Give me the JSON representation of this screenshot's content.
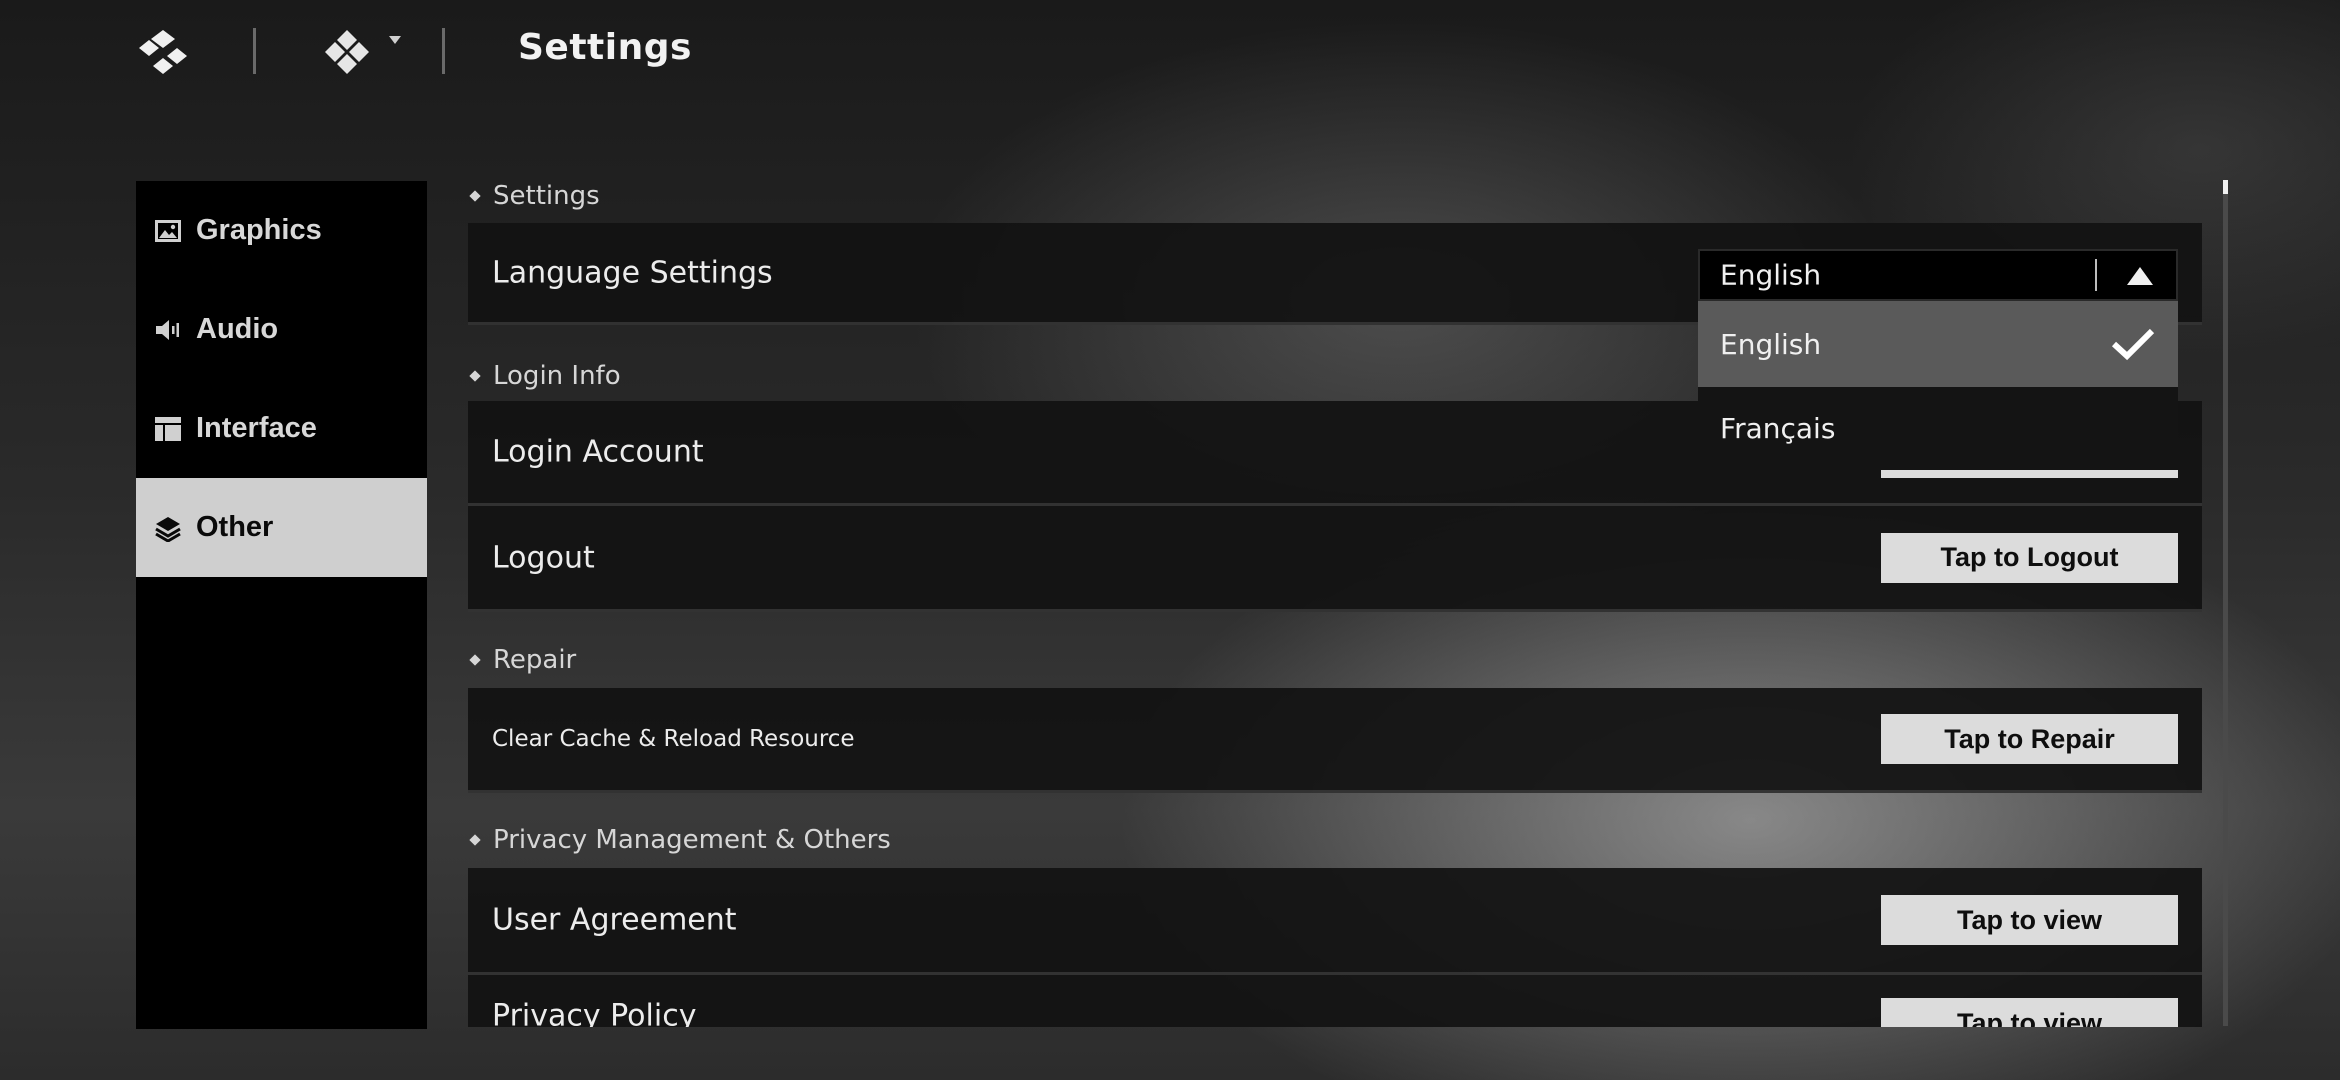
{
  "header": {
    "title": "Settings",
    "logo_icon": "diamond-logo-icon",
    "switch_icon": "four-diamond-icon",
    "switch_caret_icon": "caret-down-icon"
  },
  "sidebar": {
    "items": [
      {
        "label": "Graphics",
        "icon": "image-icon",
        "active": false
      },
      {
        "label": "Audio",
        "icon": "speaker-icon",
        "active": false
      },
      {
        "label": "Interface",
        "icon": "layout-icon",
        "active": false
      },
      {
        "label": "Other",
        "icon": "layers-icon",
        "active": true
      }
    ]
  },
  "sections": {
    "settings": {
      "heading": "Settings",
      "language": {
        "label": "Language Settings"
      }
    },
    "login_info": {
      "heading": "Login Info",
      "login_account": {
        "label": "Login Account"
      },
      "logout": {
        "label": "Logout",
        "button": "Tap to Logout"
      }
    },
    "repair": {
      "heading": "Repair",
      "clear_cache": {
        "label": "Clear Cache & Reload Resource",
        "button": "Tap to Repair"
      }
    },
    "privacy": {
      "heading": "Privacy Management & Others",
      "user_agreement": {
        "label": "User Agreement",
        "button": "Tap to view"
      },
      "privacy_policy": {
        "label": "Privacy Policy",
        "button": "Tap to view"
      }
    }
  },
  "language_dropdown": {
    "selected": "English",
    "expanded": true,
    "options": [
      "English",
      "Français"
    ],
    "checked_option": "English"
  },
  "colors": {
    "sidebar_bg": "#000000",
    "active_item_bg": "#cfcfcf",
    "row_bg": "#121212",
    "button_bg": "#dcdcdc",
    "selected_option_bg": "#5a5a5a"
  }
}
